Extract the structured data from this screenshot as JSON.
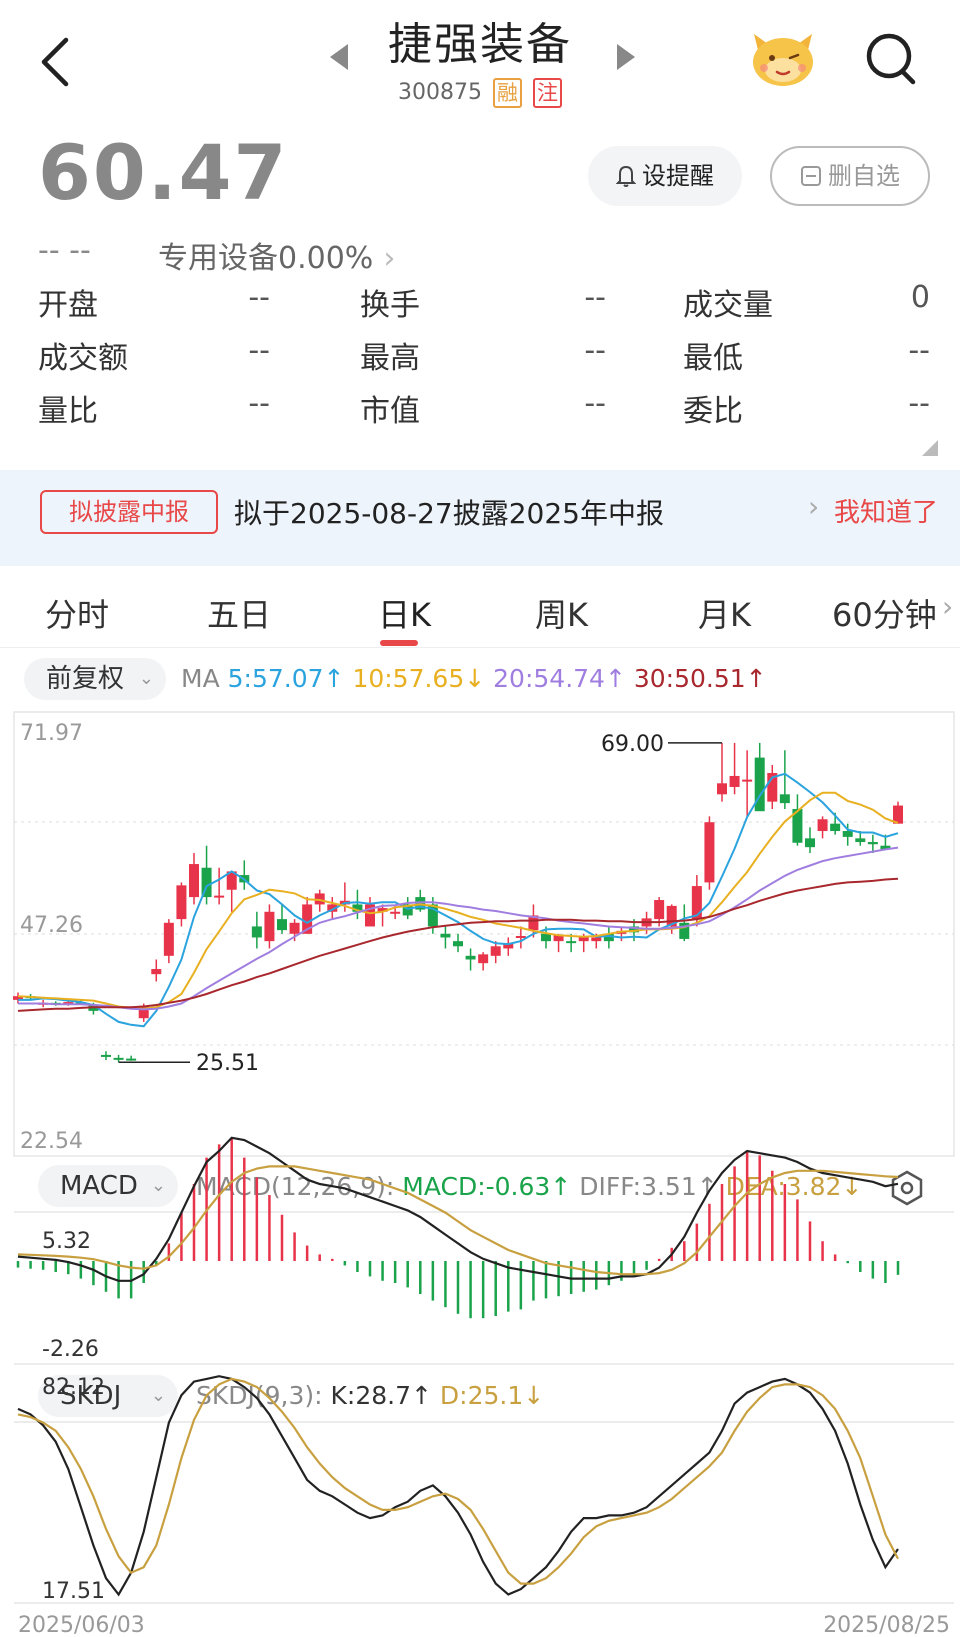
{
  "header": {
    "title": "捷强装备",
    "code": "300875",
    "tag_margin": "融",
    "tag_note": "注"
  },
  "quote": {
    "price": "60.47",
    "change": "-- --",
    "sector": "专用设备0.00%"
  },
  "actions": {
    "alert_label": "设提醒",
    "remove_label": "删自选"
  },
  "stats": [
    {
      "label": "开盘",
      "value": "--"
    },
    {
      "label": "换手",
      "value": "--"
    },
    {
      "label": "成交量",
      "value": "0"
    },
    {
      "label": "成交额",
      "value": "--"
    },
    {
      "label": "最高",
      "value": "--"
    },
    {
      "label": "最低",
      "value": "--"
    },
    {
      "label": "量比",
      "value": "--"
    },
    {
      "label": "市值",
      "value": "--"
    },
    {
      "label": "委比",
      "value": "--"
    }
  ],
  "notice": {
    "badge": "拟披露中报",
    "text": "拟于2025-08-27披露2025年中报",
    "link": "我知道了"
  },
  "tabs": [
    "分时",
    "五日",
    "日K",
    "周K",
    "月K",
    "60分钟"
  ],
  "active_tab": "日K",
  "ma_bar": {
    "adjust": "前复权",
    "prefix": "MA",
    "ma5": "5:57.07↑",
    "ma10": "10:57.65↓",
    "ma20": "20:54.74↑",
    "ma30": "30:50.51↑"
  },
  "macd_bar": {
    "name": "MACD",
    "params": "MACD(12,26,9):",
    "macd": "MACD:-0.63↑",
    "diff": "DIFF:3.51↑",
    "dea": "DEA:3.82↓"
  },
  "kdj_bar": {
    "name": "SKDJ",
    "params": "SKDJ(9,3):",
    "k": "K:28.7↑",
    "d": "D:25.1↓"
  },
  "colors": {
    "up": "#e8344a",
    "down": "#1aa34a",
    "ma5": "#2aa3de",
    "ma10": "#e8b020",
    "ma20": "#a07ee0",
    "ma30": "#a8282e",
    "diff": "#222222",
    "dea": "#c8a040"
  },
  "chart_data": [
    {
      "type": "candlestick",
      "title": "日K",
      "y_ticks": [
        "71.97",
        "47.26",
        "22.54"
      ],
      "ylim": [
        22.54,
        71.97
      ],
      "annotations": [
        {
          "label": "69.00",
          "value": 69.0
        },
        {
          "label": "25.51",
          "value": 25.51
        }
      ],
      "x_ticks": [
        "2025/06/03",
        "2025/08/25"
      ],
      "candles": [
        [
          34,
          35,
          33.5,
          34.5
        ],
        [
          34.5,
          34.8,
          34,
          34.3
        ],
        [
          33.5,
          34,
          33,
          33.6
        ],
        [
          33.6,
          33.8,
          33.2,
          33.5
        ],
        [
          33.5,
          33.9,
          33.2,
          33.7
        ],
        [
          33.7,
          34,
          33.3,
          33.4
        ],
        [
          33.4,
          33.6,
          32,
          32.5
        ],
        [
          26.5,
          27,
          25.8,
          26.3
        ],
        [
          26.1,
          26.5,
          25.51,
          25.9
        ],
        [
          26,
          26.4,
          25.7,
          25.8
        ],
        [
          31.5,
          33.5,
          31,
          33.2
        ],
        [
          37.5,
          39.5,
          36.5,
          38.2
        ],
        [
          40,
          45,
          39,
          44.5
        ],
        [
          45,
          50,
          44,
          49.6
        ],
        [
          48,
          54,
          47,
          52.5
        ],
        [
          52,
          55,
          47,
          48
        ],
        [
          48,
          52,
          47,
          48.2
        ],
        [
          49,
          51,
          46,
          51.5
        ],
        [
          51,
          53,
          49,
          50
        ],
        [
          44,
          46,
          41,
          42.5
        ],
        [
          42,
          47,
          41,
          46
        ],
        [
          45,
          47,
          43,
          43.5
        ],
        [
          43,
          45,
          42,
          44.5
        ],
        [
          43,
          48,
          43,
          47
        ],
        [
          47,
          49,
          46,
          48.5
        ],
        [
          46,
          48,
          45,
          47
        ],
        [
          47,
          50,
          46,
          47.5
        ],
        [
          47,
          49,
          45,
          46
        ],
        [
          44,
          48,
          44,
          47
        ],
        [
          46,
          47,
          44,
          46.5
        ],
        [
          46,
          47,
          45,
          46
        ],
        [
          47,
          48,
          45,
          45.5
        ],
        [
          48,
          49,
          46,
          46.3
        ],
        [
          47,
          48,
          43,
          44
        ],
        [
          43,
          44,
          41,
          42.5
        ],
        [
          42,
          43,
          40.5,
          41.3
        ],
        [
          40,
          41,
          38,
          39.5
        ],
        [
          39,
          40.5,
          38,
          40.2
        ],
        [
          40,
          42,
          39,
          41.3
        ],
        [
          41,
          42.5,
          40,
          41.7
        ],
        [
          42.5,
          44,
          41,
          42.7
        ],
        [
          43.5,
          47,
          42.5,
          45.5
        ],
        [
          43,
          44,
          41,
          42
        ],
        [
          42,
          43,
          40.5,
          42.8
        ],
        [
          42,
          43,
          40.5,
          41.8
        ],
        [
          42,
          43,
          40.5,
          42.6
        ],
        [
          42,
          43,
          41,
          42.5
        ],
        [
          43,
          44,
          41,
          42
        ],
        [
          43,
          44,
          42,
          43.4
        ],
        [
          44,
          45,
          42,
          43.2
        ],
        [
          44,
          46,
          43,
          45.1
        ],
        [
          45,
          48,
          44,
          47.6
        ],
        [
          44,
          47,
          43,
          46.8
        ],
        [
          44.5,
          47,
          42,
          42.3
        ],
        [
          45,
          51,
          44,
          49.5
        ],
        [
          50,
          59,
          49,
          58.2
        ],
        [
          62,
          69,
          61,
          63.5
        ],
        [
          63,
          69,
          62,
          64.5
        ],
        [
          64,
          68,
          59,
          64
        ],
        [
          67,
          69,
          60,
          59.7
        ],
        [
          61,
          66,
          60,
          64.9
        ],
        [
          62,
          68,
          60,
          60.8
        ],
        [
          60,
          62,
          55,
          55.4
        ],
        [
          56,
          57.5,
          54,
          54.8
        ],
        [
          57,
          59,
          56,
          58.6
        ],
        [
          58,
          59.5,
          56.5,
          57
        ],
        [
          57,
          58,
          55,
          56.2
        ],
        [
          56,
          57,
          55,
          55.5
        ],
        [
          55.5,
          56.5,
          54,
          55.2
        ],
        [
          55,
          56.5,
          54.5,
          54.5
        ],
        [
          58,
          61,
          58,
          60.47
        ]
      ],
      "series": [
        {
          "name": "5",
          "values": [
            34,
            34,
            34.2,
            34.1,
            33.9,
            33.7,
            33.3,
            32.1,
            31,
            30.6,
            30.4,
            32.5,
            35.8,
            39.5,
            45.3,
            49.5,
            50.4,
            51.5,
            50.4,
            48.9,
            48.4,
            47,
            45.5,
            44.5,
            45.5,
            46.3,
            47.2,
            47.3,
            47.1,
            47.3,
            47.3,
            46.4,
            46.7,
            46.4,
            45.5,
            44.6,
            43.4,
            42.3,
            41.7,
            41.6,
            42,
            43,
            43.6,
            43.7,
            43.7,
            43.6,
            42.6,
            42.7,
            42.5,
            42.6,
            42.5,
            43.6,
            44.3,
            45.1,
            45.5,
            47.2,
            50.8,
            54.6,
            58.9,
            61.8,
            64.3,
            64.8,
            63.6,
            62.3,
            60.9,
            59.1,
            57.2,
            56.8,
            56.8,
            56.2,
            56.7
          ]
        },
        {
          "name": "10",
          "values": [
            34.5,
            34.4,
            34.3,
            34.2,
            34.1,
            34,
            33.9,
            33.5,
            33.1,
            32.9,
            32.8,
            33,
            33.7,
            34.8,
            37.7,
            40.9,
            43.3,
            45.8,
            47.7,
            48.3,
            49,
            48.8,
            48.5,
            47.7,
            47.6,
            47.2,
            46.8,
            46.2,
            45.8,
            46,
            46.6,
            46.8,
            47,
            46.8,
            46.4,
            45.9,
            45.3,
            44.9,
            44.4,
            44.1,
            43.8,
            43.4,
            43.1,
            42.8,
            42.7,
            42.6,
            42.7,
            43,
            43.3,
            43.4,
            43.6,
            43.6,
            43.7,
            43.9,
            44.5,
            45.4,
            47.3,
            49.4,
            51.4,
            53.9,
            56.2,
            58.3,
            59.7,
            61.2,
            62.2,
            62.2,
            61.1,
            60.6,
            59.9,
            58.7,
            58.1
          ]
        },
        {
          "name": "20",
          "values": [
            33.5,
            33.5,
            33.5,
            33.4,
            33.4,
            33.4,
            33.3,
            33.2,
            33,
            32.8,
            32.7,
            32.8,
            33.1,
            33.5,
            34.5,
            35.6,
            36.6,
            37.6,
            38.6,
            39.6,
            40.5,
            41.6,
            42.6,
            43.6,
            44.5,
            45,
            45.4,
            45.9,
            46.4,
            46.8,
            46.9,
            47.2,
            47.3,
            47.3,
            47.1,
            46.8,
            46.6,
            46.3,
            46.1,
            45.8,
            45.5,
            45.3,
            45.1,
            44.8,
            44.6,
            44.4,
            44.2,
            44,
            43.9,
            43.8,
            43.7,
            43.7,
            43.8,
            44,
            44.3,
            44.7,
            45.6,
            46.6,
            47.7,
            48.9,
            49.9,
            50.9,
            51.7,
            52.3,
            52.9,
            53.3,
            53.6,
            53.9,
            54.2,
            54.5,
            54.74
          ]
        },
        {
          "name": "30",
          "values": [
            32.5,
            32.6,
            32.7,
            32.8,
            32.8,
            32.9,
            33,
            33,
            33,
            33,
            33.1,
            33.3,
            33.6,
            33.9,
            34.3,
            34.8,
            35.4,
            36,
            36.5,
            37.1,
            37.6,
            38.2,
            38.8,
            39.4,
            40,
            40.5,
            41,
            41.5,
            42,
            42.5,
            42.9,
            43.3,
            43.6,
            43.9,
            44.1,
            44.3,
            44.5,
            44.6,
            44.7,
            44.7,
            44.8,
            44.8,
            44.9,
            44.9,
            44.9,
            44.8,
            44.8,
            44.7,
            44.7,
            44.6,
            44.6,
            44.6,
            44.7,
            44.8,
            45,
            45.3,
            45.8,
            46.4,
            46.9,
            47.5,
            48,
            48.5,
            48.9,
            49.2,
            49.5,
            49.8,
            50,
            50.1,
            50.2,
            50.4,
            50.51
          ]
        }
      ]
    },
    {
      "type": "bar",
      "title": "MACD(12,26,9)",
      "y_ticks": [
        "5.32",
        "-2.26"
      ],
      "ylim": [
        -2.26,
        5.32
      ],
      "hist": [
        -0.3,
        -0.35,
        -0.4,
        -0.5,
        -0.6,
        -0.8,
        -1.1,
        -1.4,
        -1.7,
        -1.7,
        -1.0,
        -0.2,
        0.8,
        2.2,
        3.5,
        4.7,
        5.3,
        5.6,
        4.7,
        3.8,
        3.0,
        2.1,
        1.3,
        0.7,
        0.3,
        0.1,
        -0.2,
        -0.5,
        -0.7,
        -0.9,
        -1.0,
        -1.2,
        -1.5,
        -1.8,
        -2.1,
        -2.4,
        -2.6,
        -2.6,
        -2.5,
        -2.3,
        -2.2,
        -1.8,
        -1.7,
        -1.6,
        -1.5,
        -1.4,
        -1.3,
        -1.1,
        -0.9,
        -0.7,
        -0.4,
        0.1,
        0.6,
        0.9,
        1.7,
        2.6,
        3.5,
        4.3,
        5.0,
        4.8,
        4.1,
        3.5,
        2.8,
        1.8,
        0.9,
        0.3,
        -0.1,
        -0.5,
        -0.8,
        -1.0,
        -0.63
      ],
      "series": [
        {
          "name": "DIFF",
          "values": [
            0.2,
            0.15,
            0.1,
            0.05,
            -0.05,
            -0.2,
            -0.4,
            -0.7,
            -0.9,
            -0.9,
            -0.6,
            0.1,
            1.0,
            2.2,
            3.4,
            4.5,
            5.0,
            5.6,
            5.5,
            5.2,
            4.9,
            4.5,
            4.1,
            3.7,
            3.5,
            3.4,
            3.3,
            3.1,
            2.9,
            2.7,
            2.5,
            2.3,
            2.0,
            1.6,
            1.2,
            0.8,
            0.4,
            0.1,
            -0.1,
            -0.3,
            -0.4,
            -0.5,
            -0.6,
            -0.7,
            -0.8,
            -0.8,
            -0.8,
            -0.8,
            -0.7,
            -0.7,
            -0.6,
            -0.3,
            0.3,
            1.1,
            2.2,
            3.2,
            4.0,
            4.6,
            5.0,
            4.9,
            4.8,
            4.7,
            4.5,
            4.2,
            4.0,
            3.9,
            3.8,
            3.7,
            3.6,
            3.4,
            3.51
          ]
        },
        {
          "name": "DEA",
          "values": [
            0.3,
            0.28,
            0.26,
            0.23,
            0.2,
            0.15,
            0.08,
            -0.05,
            -0.2,
            -0.3,
            -0.35,
            -0.2,
            0.2,
            0.8,
            1.5,
            2.3,
            3.0,
            3.6,
            4.0,
            4.2,
            4.3,
            4.3,
            4.3,
            4.2,
            4.1,
            4.0,
            3.9,
            3.8,
            3.7,
            3.5,
            3.3,
            3.1,
            2.8,
            2.5,
            2.2,
            1.8,
            1.4,
            1.1,
            0.8,
            0.5,
            0.3,
            0.1,
            -0.1,
            -0.2,
            -0.3,
            -0.4,
            -0.5,
            -0.55,
            -0.6,
            -0.6,
            -0.6,
            -0.55,
            -0.4,
            -0.1,
            0.4,
            1.1,
            1.8,
            2.5,
            3.1,
            3.5,
            3.8,
            4.0,
            4.1,
            4.1,
            4.1,
            4.05,
            4.0,
            3.95,
            3.9,
            3.85,
            3.82
          ]
        }
      ]
    },
    {
      "type": "line",
      "title": "SKDJ(9,3)",
      "y_ticks": [
        "82.12",
        "17.51"
      ],
      "ylim": [
        17.51,
        82.12
      ],
      "series": [
        {
          "name": "K",
          "values": [
            80,
            78,
            74,
            68,
            58,
            44,
            30,
            18,
            12,
            20,
            35,
            55,
            75,
            85,
            90,
            91,
            92,
            91,
            88,
            84,
            78,
            70,
            62,
            54,
            50,
            48,
            45,
            42,
            40,
            41,
            44,
            46,
            50,
            52,
            48,
            42,
            34,
            24,
            16,
            12,
            14,
            18,
            22,
            28,
            35,
            40,
            40,
            41,
            41,
            42,
            44,
            48,
            52,
            56,
            60,
            64,
            72,
            82,
            86,
            88,
            90,
            91,
            89,
            86,
            80,
            72,
            60,
            45,
            32,
            22,
            28.7
          ]
        },
        {
          "name": "D",
          "values": [
            78,
            77,
            75,
            72,
            66,
            58,
            48,
            36,
            26,
            20,
            22,
            30,
            45,
            62,
            76,
            85,
            89,
            91,
            90,
            88,
            84,
            79,
            73,
            66,
            60,
            55,
            51,
            48,
            45,
            43,
            43,
            44,
            46,
            48,
            49,
            47,
            43,
            36,
            28,
            20,
            16,
            16,
            18,
            22,
            27,
            33,
            37,
            39,
            40,
            41,
            42,
            44,
            47,
            51,
            55,
            59,
            64,
            72,
            79,
            84,
            88,
            89,
            89,
            88,
            85,
            80,
            72,
            62,
            48,
            34,
            25.1
          ]
        }
      ]
    }
  ]
}
